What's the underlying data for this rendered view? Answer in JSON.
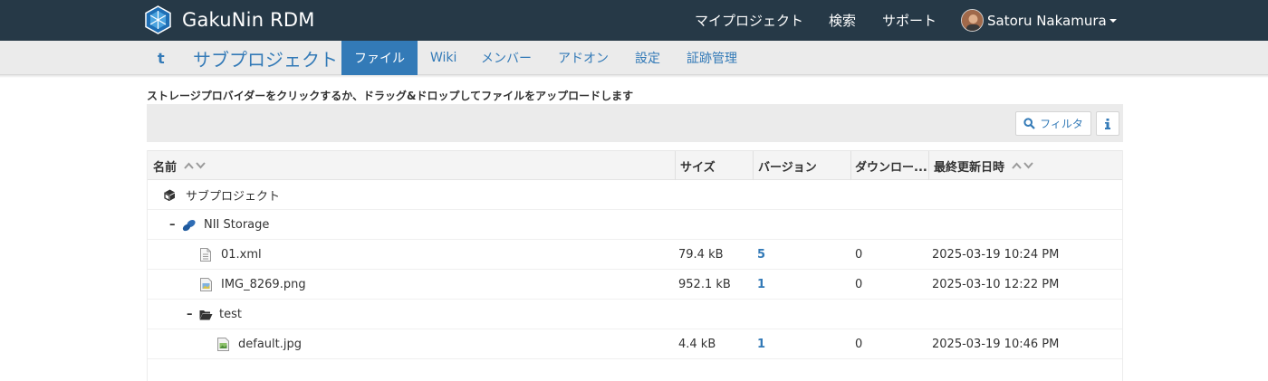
{
  "app": {
    "name": "GakuNin RDM",
    "colors": {
      "navbar": "#263947",
      "accent": "#337ab7",
      "subnav": "#ebebeb"
    }
  },
  "topnav": {
    "my_projects": "マイプロジェクト",
    "search": "検索",
    "support": "サポート",
    "user_name": "Satoru Nakamura"
  },
  "project_nav": {
    "parent_link": "t",
    "project_title": "サブプロジェクト",
    "tabs": [
      {
        "label": "ファイル",
        "active": true
      },
      {
        "label": "Wiki"
      },
      {
        "label": "メンバー"
      },
      {
        "label": "アドオン"
      },
      {
        "label": "設定"
      },
      {
        "label": "証跡管理"
      }
    ]
  },
  "files": {
    "instruction": "ストレージプロバイダーをクリックするか、ドラッグ&ドロップしてファイルをアップロードします",
    "filter_label": "フィルタ",
    "info_icon": "info-icon",
    "columns": {
      "name": "名前",
      "size": "サイズ",
      "version": "バージョン",
      "downloads": "ダウンロー...",
      "modified": "最終更新日時"
    },
    "rows": [
      {
        "kind": "project",
        "name": "サブプロジェクト",
        "icon": "cube-icon"
      },
      {
        "kind": "provider",
        "toggle": "–",
        "name": "NII Storage",
        "icon": "storage-icon"
      },
      {
        "kind": "file",
        "name": "01.xml",
        "size": "79.4 kB",
        "version": "5",
        "downloads": "0",
        "modified": "2025-03-19 10:24 PM",
        "icon": "file-text-icon"
      },
      {
        "kind": "file",
        "name": "IMG_8269.png",
        "size": "952.1 kB",
        "version": "1",
        "downloads": "0",
        "modified": "2025-03-10 12:22 PM",
        "icon": "image-file-icon"
      },
      {
        "kind": "folder",
        "toggle": "–",
        "name": "test",
        "icon": "folder-open-icon"
      },
      {
        "kind": "file",
        "name": "default.jpg",
        "size": "4.4 kB",
        "version": "1",
        "downloads": "0",
        "modified": "2025-03-19 10:46 PM",
        "icon": "image-file-icon"
      }
    ]
  }
}
